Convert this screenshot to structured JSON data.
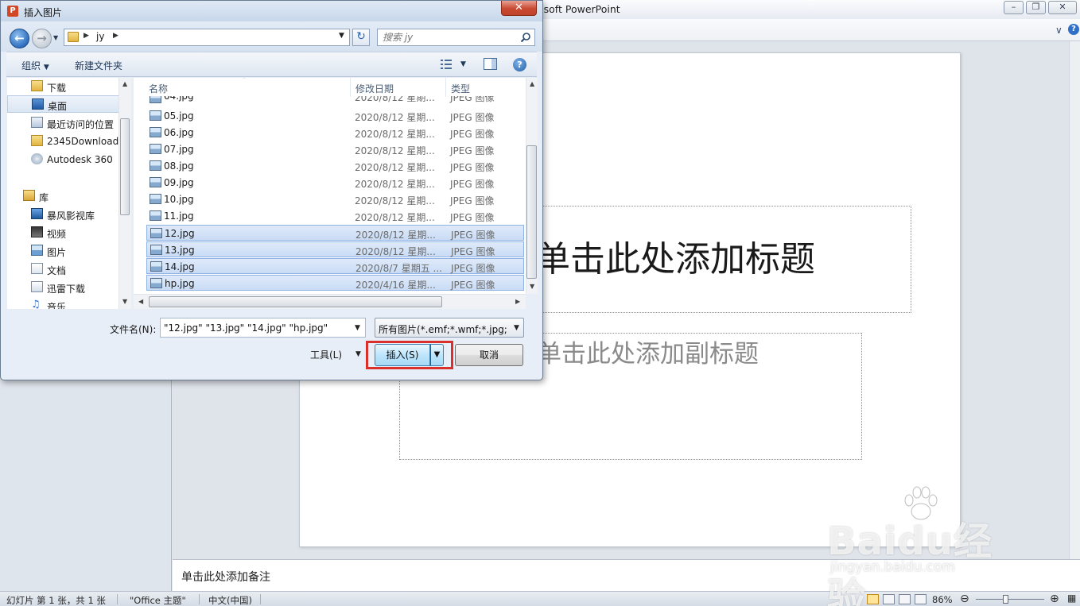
{
  "powerpoint": {
    "title": "osoft PowerPoint",
    "slide": {
      "title_placeholder": "单击此处添加标题",
      "subtitle_placeholder": "单击此处添加副标题"
    },
    "notes_placeholder": "单击此处添加备注",
    "status": {
      "slide_info": "幻灯片 第 1 张，共 1 张",
      "theme": "\"Office 主题\"",
      "language": "中文(中国)",
      "zoom": "86%",
      "zoom_level_percent": 86
    }
  },
  "dialog": {
    "title": "插入图片",
    "close_label": "✕",
    "address": {
      "path": "jy"
    },
    "search": {
      "placeholder": "搜索 jy"
    },
    "toolbar": {
      "organize": "组织",
      "new_folder": "新建文件夹"
    },
    "nav_items": [
      {
        "label": "下载",
        "icon": "download-folder-icon"
      },
      {
        "label": "桌面",
        "icon": "desktop-icon",
        "selected": true
      },
      {
        "label": "最近访问的位置",
        "icon": "recent-places-icon"
      },
      {
        "label": "2345Download:",
        "icon": "folder-icon"
      },
      {
        "label": "Autodesk 360",
        "icon": "cloud-icon"
      },
      {
        "label": "库",
        "icon": "library-icon",
        "group": true
      },
      {
        "label": "暴风影视库",
        "icon": "video-library-icon"
      },
      {
        "label": "视频",
        "icon": "video-icon"
      },
      {
        "label": "图片",
        "icon": "pictures-icon"
      },
      {
        "label": "文档",
        "icon": "documents-icon"
      },
      {
        "label": "迅雷下载",
        "icon": "download-icon"
      },
      {
        "label": "音乐",
        "icon": "music-icon"
      }
    ],
    "columns": {
      "name": "名称",
      "date": "修改日期",
      "type": "类型"
    },
    "files": [
      {
        "name": "04.jpg",
        "date": "2020/8/12 星期...",
        "type": "JPEG 图像",
        "selected": false
      },
      {
        "name": "05.jpg",
        "date": "2020/8/12 星期...",
        "type": "JPEG 图像",
        "selected": false
      },
      {
        "name": "06.jpg",
        "date": "2020/8/12 星期...",
        "type": "JPEG 图像",
        "selected": false
      },
      {
        "name": "07.jpg",
        "date": "2020/8/12 星期...",
        "type": "JPEG 图像",
        "selected": false
      },
      {
        "name": "08.jpg",
        "date": "2020/8/12 星期...",
        "type": "JPEG 图像",
        "selected": false
      },
      {
        "name": "09.jpg",
        "date": "2020/8/12 星期...",
        "type": "JPEG 图像",
        "selected": false
      },
      {
        "name": "10.jpg",
        "date": "2020/8/12 星期...",
        "type": "JPEG 图像",
        "selected": false
      },
      {
        "name": "11.jpg",
        "date": "2020/8/12 星期...",
        "type": "JPEG 图像",
        "selected": false
      },
      {
        "name": "12.jpg",
        "date": "2020/8/12 星期...",
        "type": "JPEG 图像",
        "selected": true
      },
      {
        "name": "13.jpg",
        "date": "2020/8/12 星期...",
        "type": "JPEG 图像",
        "selected": true
      },
      {
        "name": "14.jpg",
        "date": "2020/8/7 星期五 ...",
        "type": "JPEG 图像",
        "selected": true
      },
      {
        "name": "hp.jpg",
        "date": "2020/4/16 星期...",
        "type": "JPEG 图像",
        "selected": true
      }
    ],
    "filename_label": "文件名(N):",
    "filename_value": "\"12.jpg\" \"13.jpg\" \"14.jpg\" \"hp.jpg\"",
    "filter_value": "所有图片(*.emf;*.wmf;*.jpg;*.jp",
    "tools_label": "工具(L)",
    "insert_label": "插入(S)",
    "cancel_label": "取消"
  },
  "watermark": {
    "brand": "Baidu经验",
    "url": "jingyan.baidu.com"
  }
}
